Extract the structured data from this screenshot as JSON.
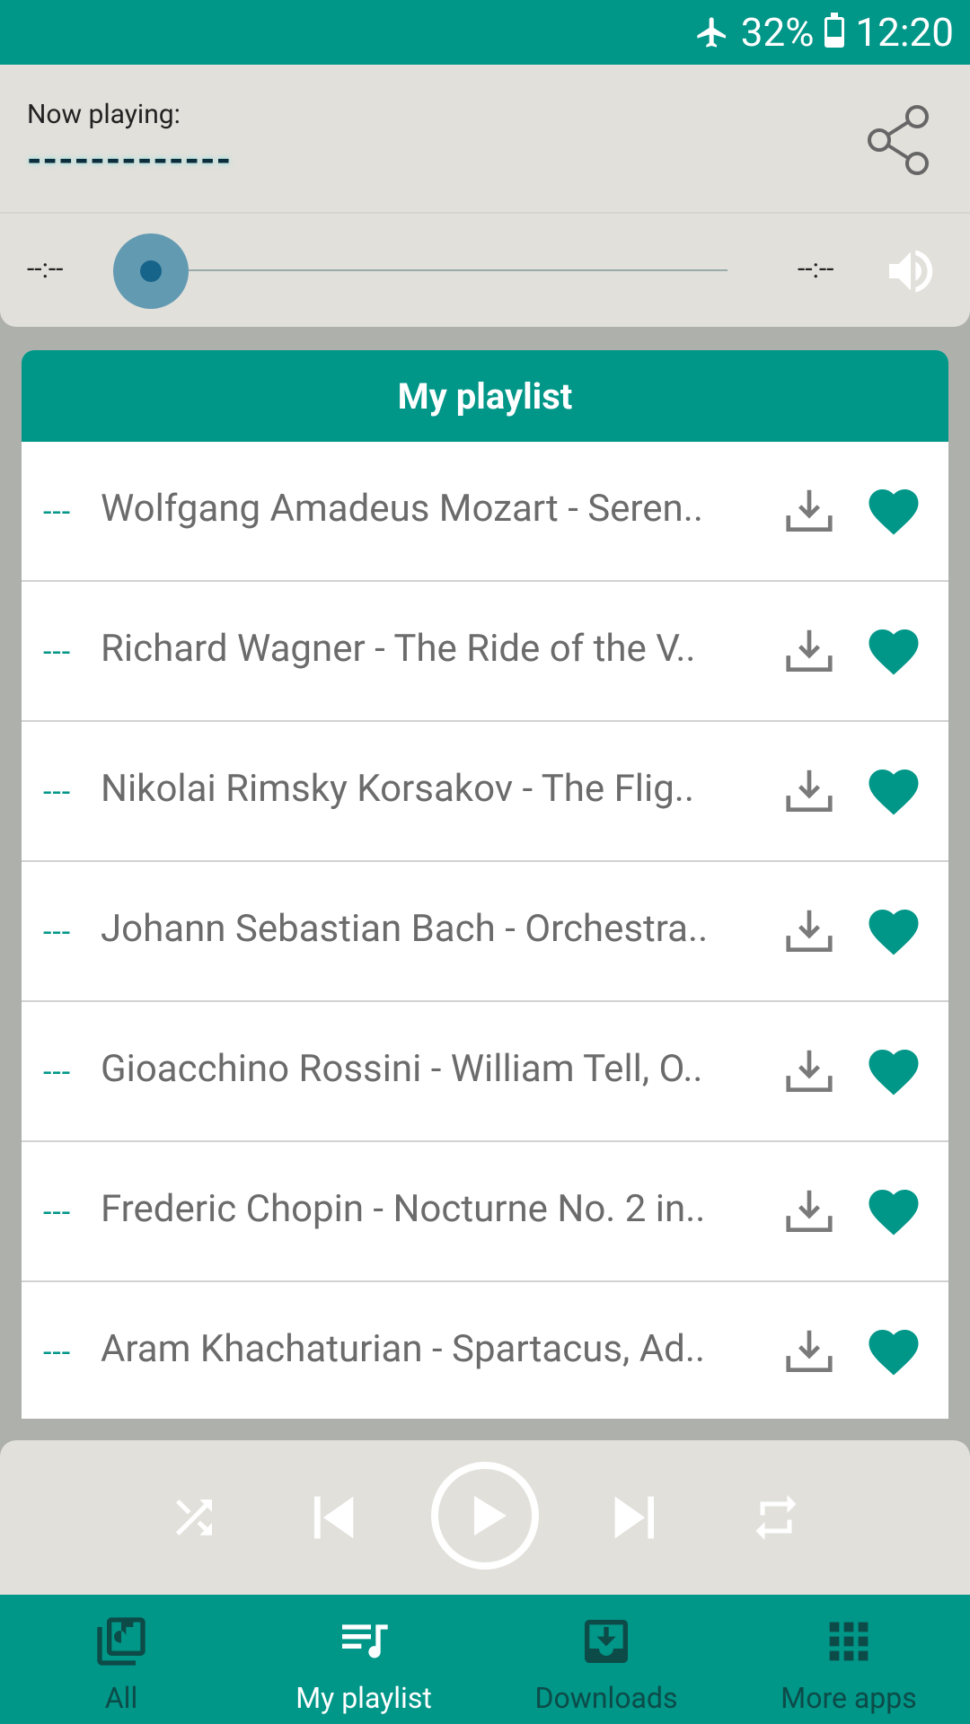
{
  "status_bar": {
    "battery": "32%",
    "time": "12:20"
  },
  "player": {
    "now_label": "Now playing:",
    "now_title": "-------------",
    "time_elapsed": "--:--",
    "time_total": "--:--"
  },
  "playlist": {
    "header": "My playlist",
    "items": [
      {
        "marker": "---",
        "title": "Wolfgang Amadeus Mozart - Seren.."
      },
      {
        "marker": "---",
        "title": "Richard Wagner - The Ride of the V.."
      },
      {
        "marker": "---",
        "title": "Nikolai Rimsky Korsakov - The Flig.."
      },
      {
        "marker": "---",
        "title": "Johann Sebastian Bach - Orchestra.."
      },
      {
        "marker": "---",
        "title": "Gioacchino Rossini - William Tell, O.."
      },
      {
        "marker": "---",
        "title": "Frederic Chopin - Nocturne No. 2 in.."
      },
      {
        "marker": "---",
        "title": "Aram Khachaturian - Spartacus, Ad.."
      }
    ]
  },
  "nav": {
    "all": "All",
    "my_playlist": "My playlist",
    "downloads": "Downloads",
    "more_apps": "More apps"
  },
  "colors": {
    "accent": "#009688",
    "panel": "#e1e0db"
  }
}
